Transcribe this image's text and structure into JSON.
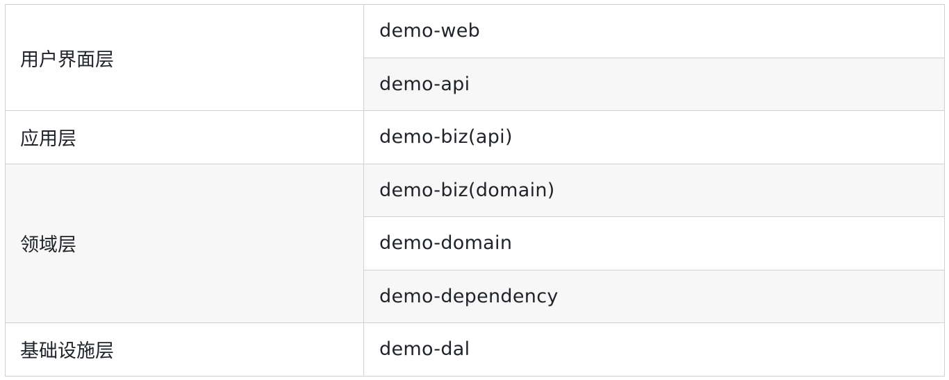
{
  "table": {
    "rows": [
      {
        "layer": "用户界面层",
        "modules": [
          "demo-web",
          "demo-api"
        ]
      },
      {
        "layer": "应用层",
        "modules": [
          "demo-biz(api)"
        ]
      },
      {
        "layer": "领域层",
        "modules": [
          "demo-biz(domain)",
          "demo-domain",
          "demo-dependency"
        ]
      },
      {
        "layer": "基础设施层",
        "modules": [
          "demo-dal"
        ]
      }
    ]
  },
  "colors": {
    "border": "#d0d0d0",
    "row_alt_bg": "#f7f7f7",
    "row_bg": "#ffffff",
    "text": "#1f2328"
  }
}
